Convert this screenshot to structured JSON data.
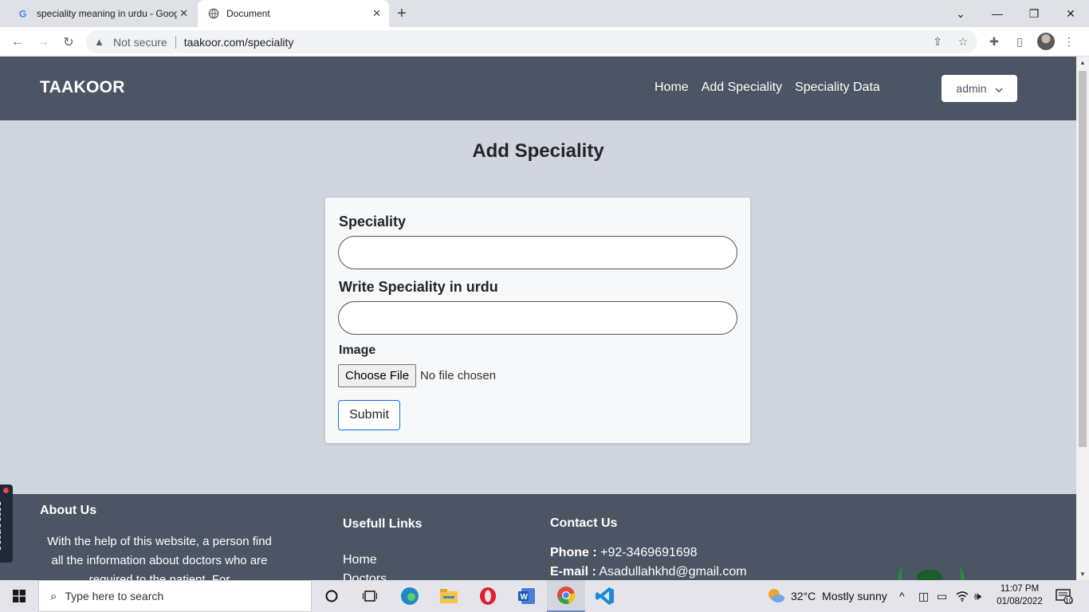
{
  "browser": {
    "tabs": [
      {
        "title": "speciality meaning in urdu - Google Search"
      },
      {
        "title": "Document"
      }
    ],
    "new_tab": "+",
    "security_label": "Not secure",
    "url": "taakoor.com/speciality"
  },
  "site": {
    "brand": "TAAKOOR",
    "nav": [
      "Home",
      "Add Speciality",
      "Speciality Data"
    ],
    "user_menu": "admin"
  },
  "main": {
    "heading": "Add Speciality",
    "form": {
      "speciality_label": "Speciality",
      "speciality_value": "",
      "urdu_label": "Write Speciality in urdu",
      "urdu_value": "",
      "image_label": "Image",
      "file_button": "Choose File",
      "file_status": "No file chosen",
      "submit": "Submit"
    }
  },
  "footer": {
    "about_title": "About Us",
    "about_text": "With the help of this website, a person find all the information about doctors who are required to the patient. For",
    "links_title": "Usefull Links",
    "links": [
      "Home",
      "Doctors"
    ],
    "contact_title": "Contact Us",
    "phone_label": "Phone :",
    "phone": "+92-3469691698",
    "email_label": "E-mail :",
    "email": "Asadullahkhd@gmail.com"
  },
  "overlay": {
    "recorder": "screenrec"
  },
  "taskbar": {
    "search_placeholder": "Type here to search",
    "weather": "32°C  Mostly sunny",
    "time": "11:07 PM",
    "date": "01/08/2022",
    "notifications": "10"
  }
}
